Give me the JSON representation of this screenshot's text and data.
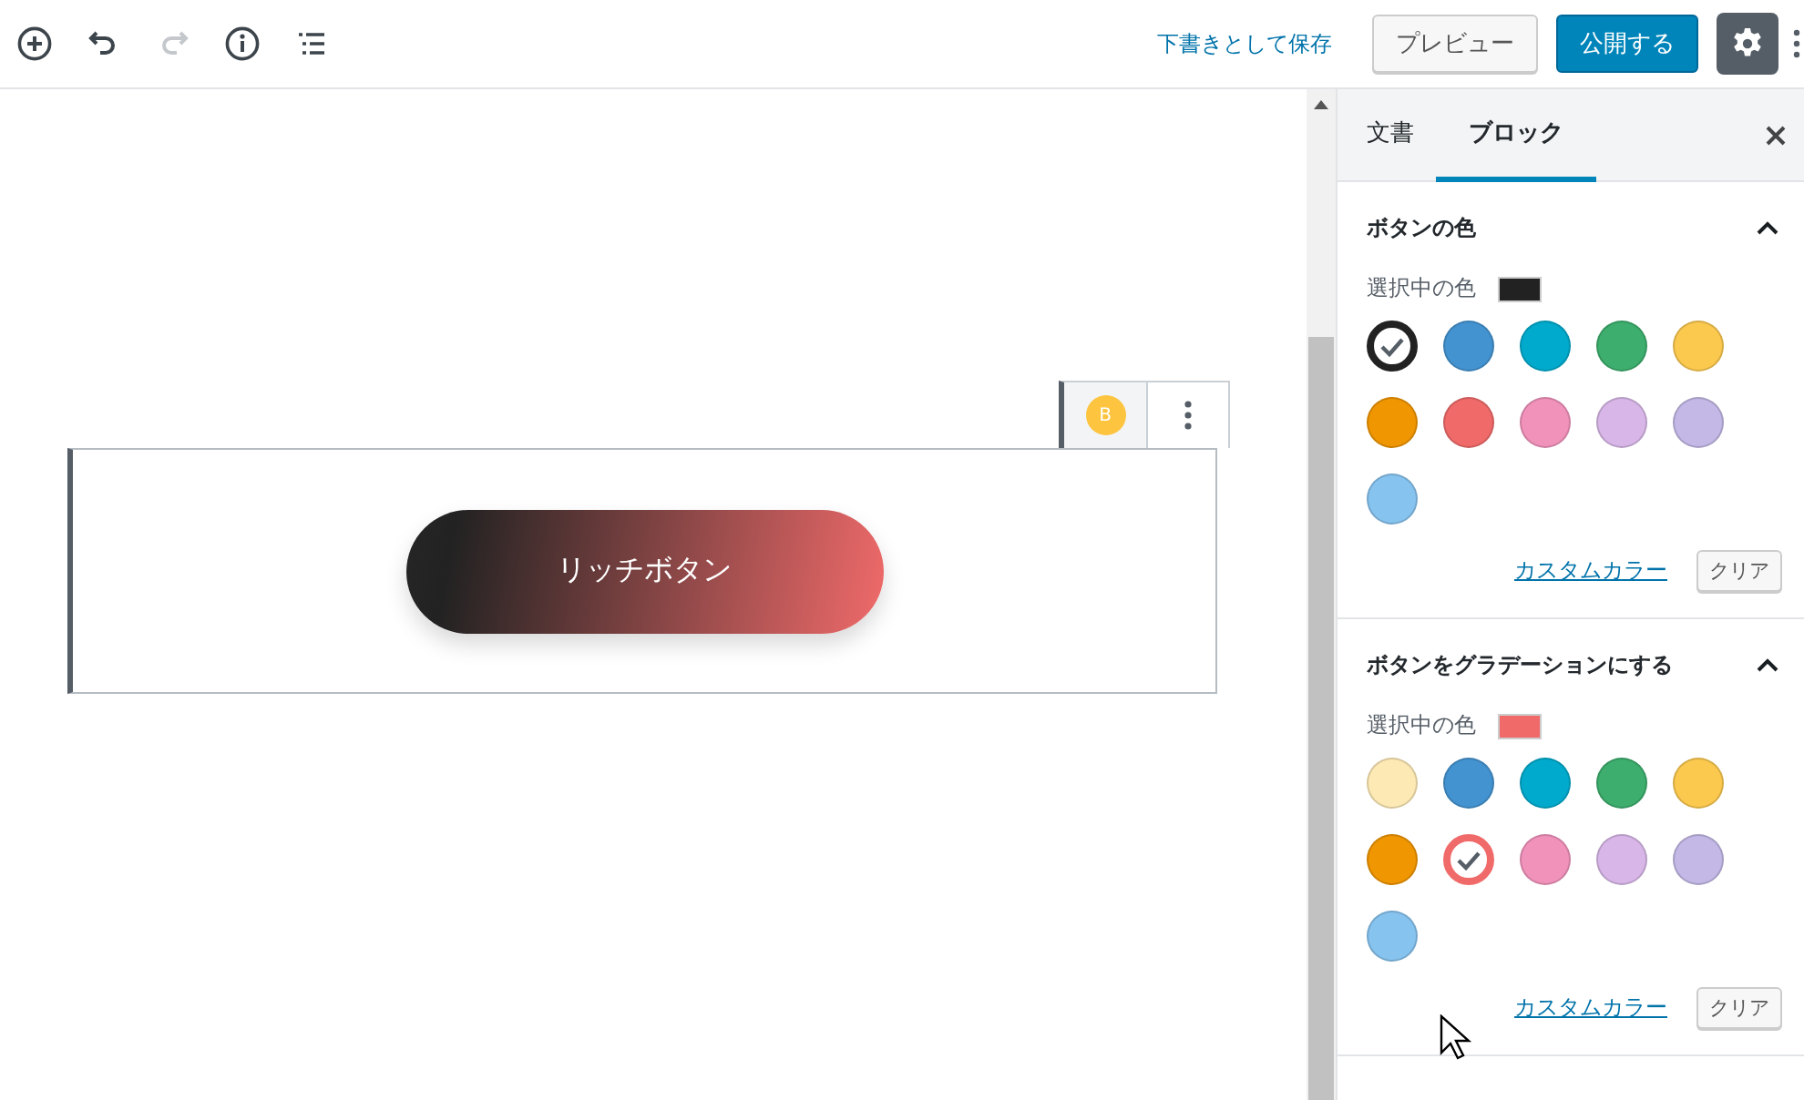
{
  "header": {
    "tools": [
      {
        "kind": "add",
        "disabled": false
      },
      {
        "kind": "undo",
        "disabled": false
      },
      {
        "kind": "redo",
        "disabled": true
      },
      {
        "kind": "info",
        "disabled": false
      },
      {
        "kind": "outline",
        "disabled": false
      }
    ],
    "save_draft": "下書きとして保存",
    "preview": "プレビュー",
    "publish": "公開する",
    "settings_active": true
  },
  "editor": {
    "block_toolbar_badge": "B",
    "button_text": "リッチボタン"
  },
  "sidebar": {
    "tabs": [
      {
        "label": "文書",
        "selected": false
      },
      {
        "label": "ブロック",
        "selected": true
      }
    ],
    "panels": [
      {
        "title": "ボタンの色",
        "expanded": true,
        "selected_label": "選択中の色",
        "custom_link": "カスタムカラー",
        "clear": "クリア",
        "palette": [
          {
            "color": "#222222",
            "selected": true
          },
          {
            "color": "#4393d1",
            "selected": false
          },
          {
            "color": "#00aacc",
            "selected": false
          },
          {
            "color": "#3dae6d",
            "selected": false
          },
          {
            "color": "#fcc94f",
            "selected": false
          },
          {
            "color": "#f09600",
            "selected": false
          },
          {
            "color": "#f06a6a",
            "selected": false
          },
          {
            "color": "#f192bb",
            "selected": false
          },
          {
            "color": "#d8b7e8",
            "selected": false
          },
          {
            "color": "#c3b8e6",
            "selected": false
          },
          {
            "color": "#87c3ef",
            "selected": false
          }
        ]
      },
      {
        "title": "ボタンをグラデーションにする",
        "expanded": true,
        "selected_label": "選択中の色",
        "custom_link": "カスタムカラー",
        "clear": "クリア",
        "palette": [
          {
            "color": "#fde9b4",
            "selected": false
          },
          {
            "color": "#4393d1",
            "selected": false
          },
          {
            "color": "#00aacc",
            "selected": false
          },
          {
            "color": "#3dae6d",
            "selected": false
          },
          {
            "color": "#fcc94f",
            "selected": false
          },
          {
            "color": "#f09600",
            "selected": false
          },
          {
            "color": "#f06a6a",
            "selected": true
          },
          {
            "color": "#f192bb",
            "selected": false
          },
          {
            "color": "#d8b7e8",
            "selected": false
          },
          {
            "color": "#c3b8e6",
            "selected": false
          },
          {
            "color": "#87c3ef",
            "selected": false
          }
        ]
      }
    ]
  }
}
